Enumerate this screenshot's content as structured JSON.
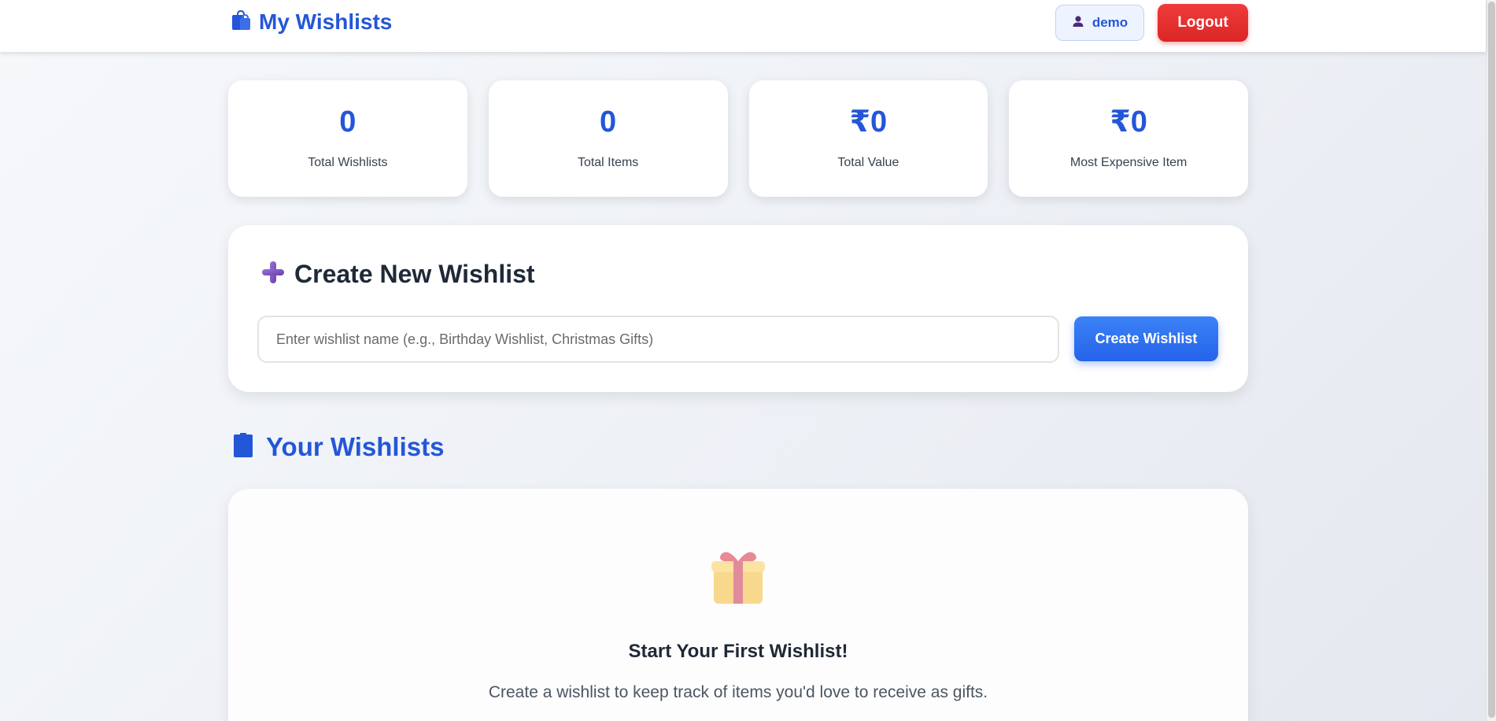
{
  "header": {
    "title": "My Wishlists",
    "username": "demo",
    "logout_label": "Logout"
  },
  "stats": [
    {
      "value": "0",
      "label": "Total Wishlists"
    },
    {
      "value": "0",
      "label": "Total Items"
    },
    {
      "value": "₹0",
      "label": "Total Value"
    },
    {
      "value": "₹0",
      "label": "Most Expensive Item"
    }
  ],
  "create": {
    "title": "Create New Wishlist",
    "input_placeholder": "Enter wishlist name (e.g., Birthday Wishlist, Christmas Gifts)",
    "input_value": "",
    "button_label": "Create Wishlist"
  },
  "wishlists_section": {
    "title": "Your Wishlists"
  },
  "empty_state": {
    "title": "Start Your First Wishlist!",
    "text": "Create a wishlist to keep track of items you'd love to receive as gifts."
  },
  "icons": {
    "brand": "shopping-bags-icon",
    "user": "user-icon",
    "create": "plus-icon",
    "section": "bookmark-icon",
    "empty": "gift-icon"
  },
  "colors": {
    "primary": "#2456d8",
    "danger": "#dc2626",
    "accent_purple": "#7c4dbd"
  }
}
